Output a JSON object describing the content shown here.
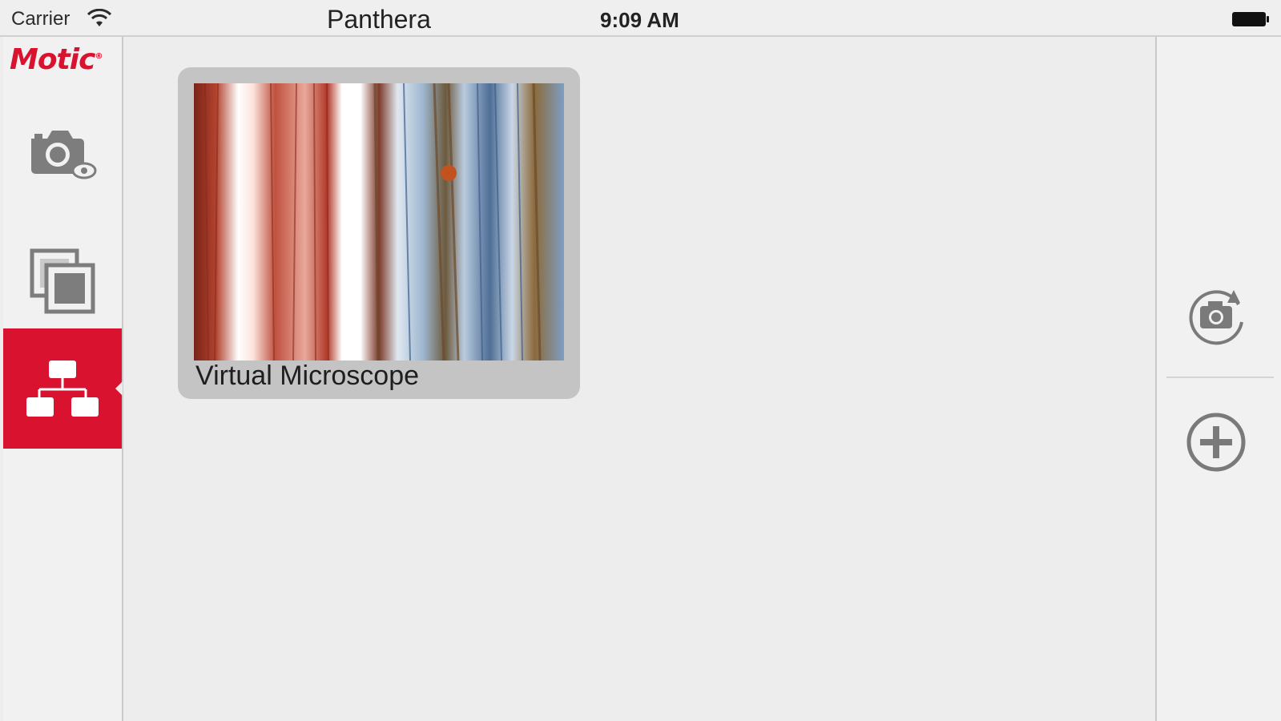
{
  "status_bar": {
    "carrier": "Carrier",
    "app_title": "Panthera",
    "time": "9:09 AM"
  },
  "sidebar": {
    "logo": "Motic",
    "items": [
      {
        "name": "camera-eye",
        "active": false
      },
      {
        "name": "gallery",
        "active": false
      },
      {
        "name": "network",
        "active": true
      }
    ]
  },
  "devices": [
    {
      "label": "Virtual Microscope"
    }
  ],
  "right_panel": {
    "buttons": [
      "refresh-camera",
      "add-device"
    ]
  },
  "colors": {
    "accent": "#d8122f",
    "background": "#ededed",
    "panel": "#f1f1f1",
    "card": "#c4c4c4",
    "icon": "#7a7a7a"
  }
}
